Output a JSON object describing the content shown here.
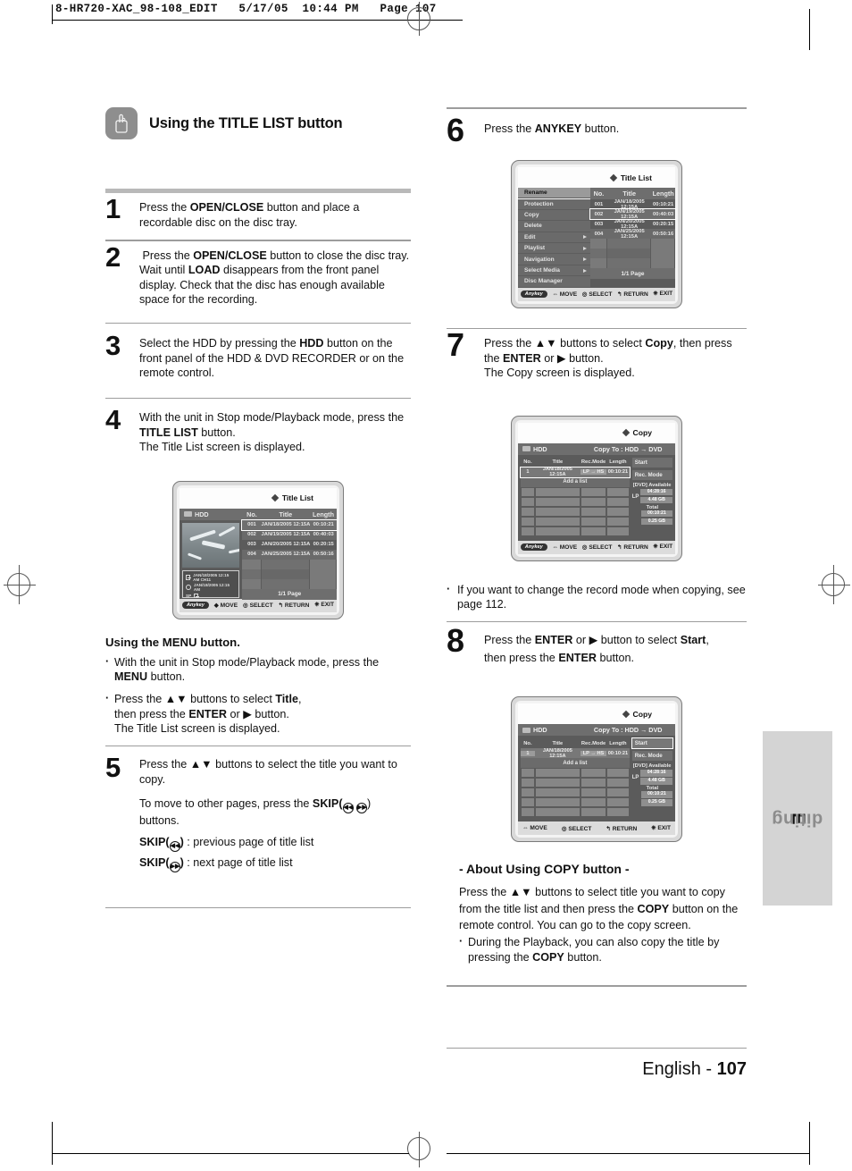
{
  "print_header": "8-HR720-XAC_98-108_EDIT   5/17/05  10:44 PM   Page 107",
  "section": {
    "icon": "press-button-icon",
    "title": "Using the TITLE LIST button"
  },
  "steps_left": [
    {
      "num": "1",
      "html": "Press the <b>OPEN/CLOSE</b> button and place a recordable disc on the disc tray."
    },
    {
      "num": "2",
      "html": "&nbsp;Press the <b>OPEN/CLOSE</b> button to close the disc tray. Wait until <b>LOAD</b> disappears from the front panel display. Check that the disc has enough available space for the recording."
    },
    {
      "num": "3",
      "html": "Select the HDD by pressing the <b>HDD</b> button on the front panel of the HDD &amp; DVD RECORDER or on the remote control."
    },
    {
      "num": "4",
      "html": "With the unit in Stop mode/Playback mode, press the <b>TITLE LIST</b> button.<br>The Title List screen is displayed."
    }
  ],
  "menu_section": {
    "heading": "Using the MENU button.",
    "bullets": [
      "With the unit in Stop mode/Playback mode, press the <b>MENU</b> button.",
      "Press the ▲▼ buttons to select <b>Title</b>,<br>then press the <b>ENTER</b> or ▶ button.<br>The Title List screen is displayed."
    ]
  },
  "step5": {
    "num": "5",
    "line1": "Press the ▲▼ buttons to select the title you want to copy.",
    "line2_pre": "To move to other pages, press the ",
    "line2_bold": "SKIP(",
    "line2_post": ") buttons.",
    "skip_prev": ": previous page of title list",
    "skip_next": ": next page of title list",
    "skip_prev_label": "SKIP(",
    "skip_next_label": "SKIP("
  },
  "steps_right": [
    {
      "num": "6",
      "html": "Press the <b>ANYKEY</b> button."
    },
    {
      "num": "7",
      "html": "Press the ▲▼ buttons to select <b>Copy</b>, then press the <b>ENTER</b> or ▶ button.<br>The Copy screen is displayed."
    },
    {
      "num": "8",
      "html": "Press the <b>ENTER</b> or ▶ button to select <b>Start</b>,<br>then press the <b>ENTER</b> button."
    }
  ],
  "note_record_mode": "If you want to change the record mode when copying, see page 112.",
  "copy_section": {
    "heading": "- About Using COPY button -",
    "para": "Press the ▲▼ buttons to select title you want to copy from the title list and then press the <b>COPY</b> button on the remote control. You can go to the copy screen.",
    "bullet": "During the Playback, you can also copy the title by pressing the <b>COPY</b> button."
  },
  "osd": {
    "title_list": {
      "screen_title": "Title List",
      "source": "HDD",
      "columns": {
        "no": "No.",
        "title": "Title",
        "length": "Length"
      },
      "rows": [
        {
          "no": "001",
          "title": "JAN/18/2005 12:15A",
          "length": "00:10:21",
          "selected": true
        },
        {
          "no": "002",
          "title": "JAN/19/2005 12:15A",
          "length": "00:40:03",
          "selected": false
        },
        {
          "no": "003",
          "title": "JAN/20/2005 12:15A",
          "length": "00:20:15",
          "selected": false
        },
        {
          "no": "004",
          "title": "JAN/25/2005 12:15A",
          "length": "00:50:16",
          "selected": false
        }
      ],
      "page": "1/1 Page",
      "info": {
        "line1": "JAN/18/2005 12:15 AM CH11",
        "line2": "JAN/18/2005 12:15 AM",
        "line3": "SP"
      },
      "footer": {
        "anykey": "Anykey",
        "move": "MOVE",
        "select": "SELECT",
        "return": "RETURN",
        "exit": "EXIT"
      }
    },
    "anykey_menu": {
      "screen_title": "Title List",
      "columns": {
        "no": "No.",
        "title": "Title",
        "length": "Length"
      },
      "items": [
        {
          "label": "Rename",
          "arrow": false,
          "selected": true
        },
        {
          "label": "Protection",
          "arrow": false,
          "selected": false
        },
        {
          "label": "Copy",
          "arrow": false,
          "selected": false
        },
        {
          "label": "Delete",
          "arrow": false,
          "selected": false
        },
        {
          "label": "Edit",
          "arrow": true,
          "selected": false
        },
        {
          "label": "Playlist",
          "arrow": true,
          "selected": false
        },
        {
          "label": "Navigation",
          "arrow": true,
          "selected": false
        },
        {
          "label": "Select Media",
          "arrow": true,
          "selected": false
        },
        {
          "label": "Disc Manager",
          "arrow": false,
          "selected": false
        }
      ],
      "rows": [
        {
          "no": "001",
          "title": "JAN/18/2005 12:15A",
          "length": "00:10:21",
          "selected": false
        },
        {
          "no": "002",
          "title": "JAN/19/2005 12:15A",
          "length": "00:40:03",
          "selected": true
        },
        {
          "no": "003",
          "title": "JAN/20/2005 12:15A",
          "length": "00:20:15",
          "selected": false
        },
        {
          "no": "004",
          "title": "JAN/25/2005 12:15A",
          "length": "00:50:16",
          "selected": false
        }
      ],
      "page": "1/1 Page",
      "footer": {
        "anykey": "Anykey",
        "move": "MOVE",
        "select": "SELECT",
        "return": "RETURN",
        "exit": "EXIT"
      }
    },
    "copy_screen": {
      "screen_title": "Copy",
      "source": "HDD",
      "copy_to": "Copy To : HDD → DVD",
      "columns": {
        "no": "No.",
        "title": "Title",
        "recmode": "Rec.Mode",
        "length": "Length"
      },
      "row": {
        "no": "1",
        "title": "JAN/18/2005 12:15A",
        "recmode": "LP → HS",
        "length": "00:10:21"
      },
      "add_list": "Add a list",
      "start": "Start",
      "rec_mode": "Rec. Mode",
      "available_label": "[DVD] Available",
      "lp_label": "LP",
      "lp_time": "04:28:16",
      "lp_size": "4.48 GB",
      "total_label": "Total",
      "total_time": "00:10:21",
      "total_size": "0.25 GB",
      "footer": {
        "anykey": "Anykey",
        "move": "MOVE",
        "select": "SELECT",
        "return": "RETURN",
        "exit": "EXIT"
      }
    },
    "copy_screen_start": {
      "screen_title": "Copy",
      "source": "HDD",
      "copy_to": "Copy To : HDD → DVD",
      "columns": {
        "no": "No.",
        "title": "Title",
        "recmode": "Rec.Mode",
        "length": "Length"
      },
      "row": {
        "no": "1",
        "title": "JAN/18/2005 12:15A",
        "recmode": "LP → HS",
        "length": "00:10:21"
      },
      "add_list": "Add a list",
      "start": "Start",
      "rec_mode": "Rec. Mode",
      "available_label": "[DVD] Available",
      "lp_label": "LP",
      "lp_time": "04:28:16",
      "lp_size": "4.48 GB",
      "total_label": "Total",
      "total_time": "00:10:21",
      "total_size": "0.25 GB",
      "footer": {
        "move": "MOVE",
        "select": "SELECT",
        "return": "RETURN",
        "exit": "EXIT"
      }
    }
  },
  "side_tab": {
    "cap": "E",
    "rest": "diting"
  },
  "footer": {
    "language": "English - ",
    "page": "107"
  }
}
